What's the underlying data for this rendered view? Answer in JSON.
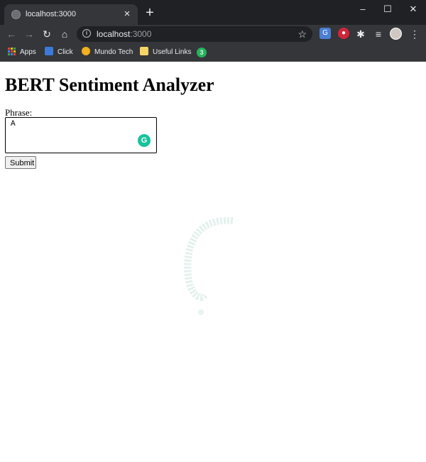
{
  "browser": {
    "tab_title": "localhost:3000",
    "tab_close": "×",
    "new_tab": "+",
    "window_controls": {
      "minimize": "–",
      "maximize": "☐",
      "close": "✕"
    },
    "address": {
      "host": "localhost",
      "port": ":3000"
    },
    "bookmarks": [
      {
        "label": "Apps",
        "icon": "apps-grid-icon"
      },
      {
        "label": "Click",
        "icon": "click-icon"
      },
      {
        "label": "Mundo Tech",
        "icon": "mundo-tech-icon"
      },
      {
        "label": "Useful Links",
        "icon": "folder-icon"
      }
    ],
    "extension_badge": "3"
  },
  "page": {
    "title": "BERT Sentiment Analyzer",
    "phrase_label": "Phrase:",
    "phrase_value": "A",
    "submit_label": "Submit"
  },
  "colors": {
    "chrome_dark": "#202124",
    "chrome_toolbar": "#35363a",
    "grammarly_green": "#15c39a"
  }
}
